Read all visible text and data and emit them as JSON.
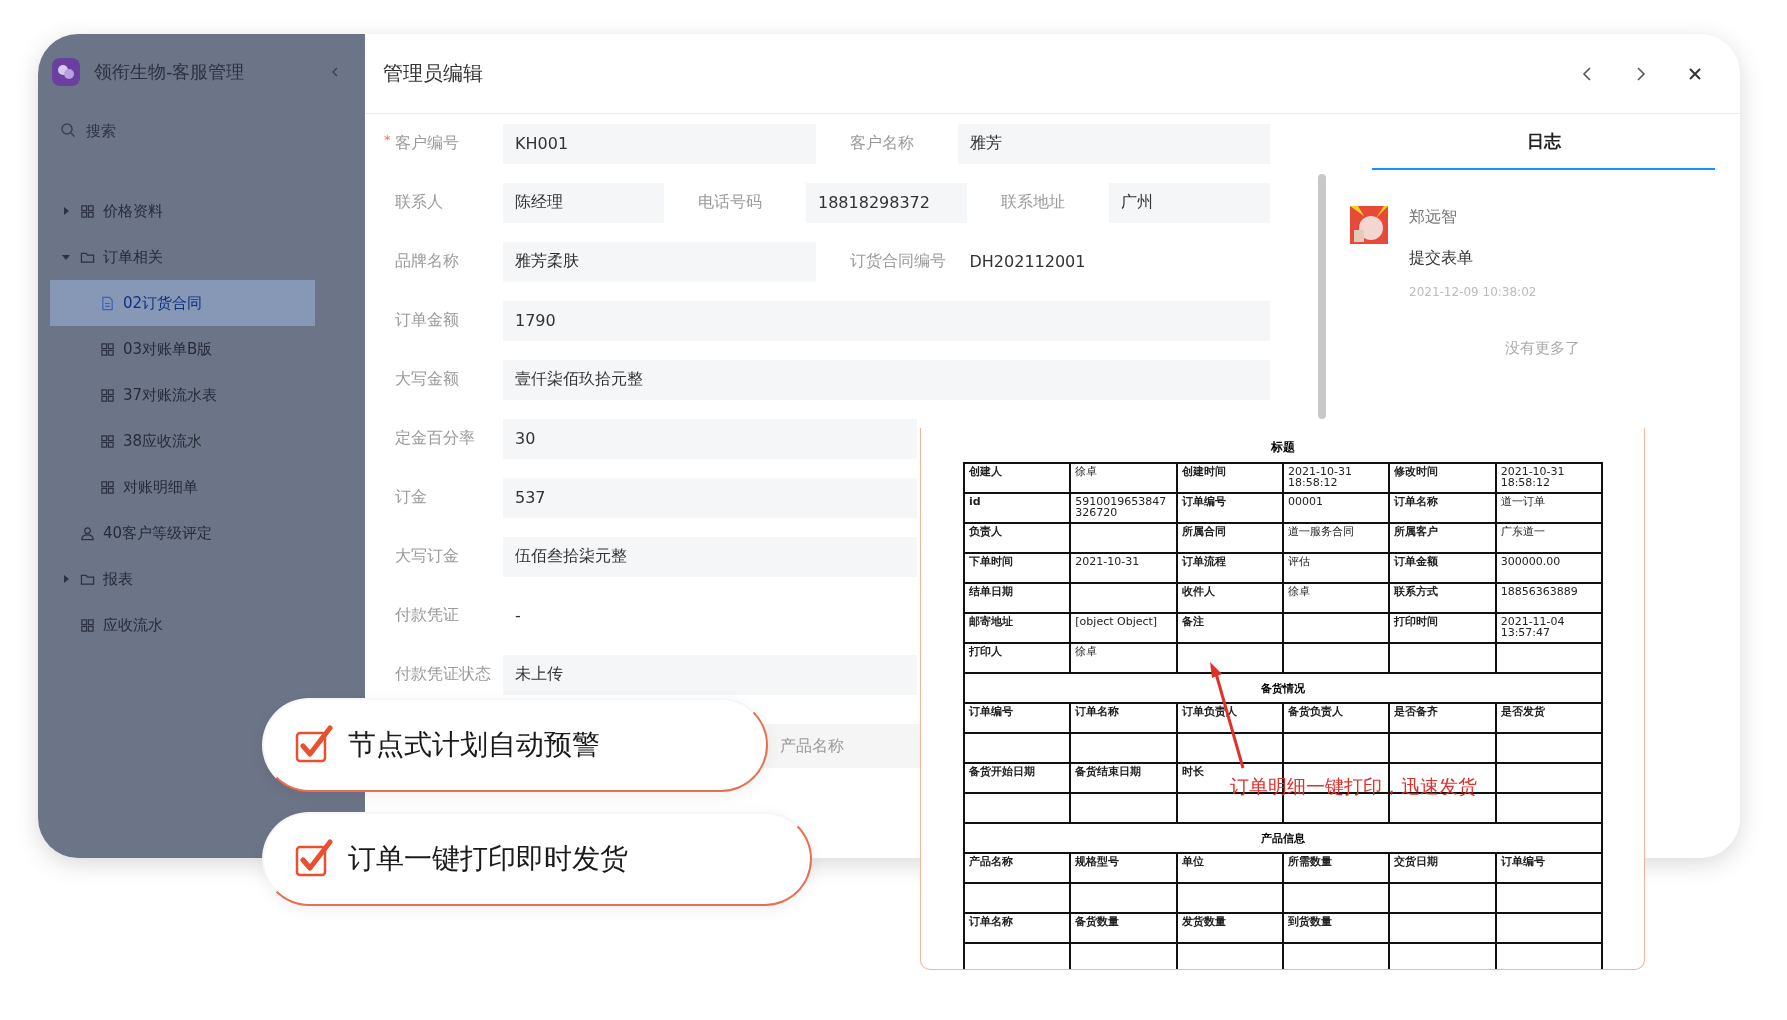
{
  "sidebar": {
    "brand": "领衔生物-客服管理",
    "search": {
      "placeholder": "搜索"
    },
    "items": [
      {
        "label": "价格资料",
        "kind": "grid",
        "expanded": false,
        "selected": false
      },
      {
        "label": "订单相关",
        "kind": "folder",
        "expanded": true,
        "selected": false,
        "children": [
          {
            "label": "02订货合同",
            "kind": "doc",
            "selected": true
          },
          {
            "label": "03对账单B版",
            "kind": "grid",
            "selected": false
          },
          {
            "label": "37对账流水表",
            "kind": "grid",
            "selected": false
          },
          {
            "label": "38应收流水",
            "kind": "grid",
            "selected": false
          },
          {
            "label": "对账明细单",
            "kind": "grid",
            "selected": false
          }
        ]
      },
      {
        "label": "40客户等级评定",
        "kind": "user",
        "selected": false
      },
      {
        "label": "报表",
        "kind": "folder",
        "expanded": false,
        "selected": false
      },
      {
        "label": "应收流水",
        "kind": "grid",
        "selected": false
      }
    ]
  },
  "dialog": {
    "title": "管理员编辑"
  },
  "form": {
    "rows": [
      {
        "fields": [
          {
            "label": "客户编号",
            "required_mark": "*",
            "kind": "input",
            "value": "KH001"
          },
          {
            "label": "客户名称",
            "kind": "input",
            "value": "雅芳"
          }
        ]
      },
      {
        "fields": [
          {
            "label": "联系人",
            "kind": "input",
            "value": "陈经理"
          },
          {
            "label": "电话号码",
            "kind": "input",
            "value": "18818298372"
          },
          {
            "label": "联系地址",
            "kind": "input",
            "value": "广州"
          }
        ]
      },
      {
        "fields": [
          {
            "label": "品牌名称",
            "kind": "input",
            "value": "雅芳柔肤"
          },
          {
            "label": "订货合同编号",
            "kind": "text",
            "value": "DH202112001"
          }
        ]
      },
      {
        "fields": [
          {
            "label": "订单金额",
            "kind": "input",
            "value": "1790"
          }
        ]
      },
      {
        "fields": [
          {
            "label": "大写金额",
            "kind": "input",
            "value": "壹仟柒佰玖拾元整"
          }
        ]
      },
      {
        "fields": [
          {
            "label": "定金百分率",
            "kind": "input",
            "value": "30"
          }
        ]
      },
      {
        "fields": [
          {
            "label": "订金",
            "kind": "input",
            "value": "537"
          }
        ]
      },
      {
        "fields": [
          {
            "label": "大写订金",
            "kind": "input",
            "value": "伍佰叁拾柒元整"
          }
        ]
      },
      {
        "fields": [
          {
            "label": "付款凭证",
            "kind": "text",
            "value": "-"
          }
        ]
      },
      {
        "fields": [
          {
            "label": "付款凭证状态",
            "kind": "input",
            "value": "未上传"
          }
        ]
      }
    ],
    "product_header": "产品名称"
  },
  "log": {
    "tab": {
      "label": "日志",
      "selected": true
    },
    "entries": [
      {
        "user": "郑远智",
        "action": "提交表单",
        "time": "2021-12-09 10:38:02"
      }
    ],
    "end_note": "没有更多了"
  },
  "callouts": [
    {
      "text": "节点式计划自动预警",
      "checked": true
    },
    {
      "text": "订单一键打印即时发货",
      "checked": true
    }
  ],
  "print_sheet": {
    "title": "标题",
    "rows": [
      {
        "kind": "pairs",
        "pairs": [
          {
            "label": "创建人",
            "value": "徐卓"
          },
          {
            "label": "创建时间",
            "value": "2021-10-31 18:58:12"
          },
          {
            "label": "修改时间",
            "value": "2021-10-31 18:58:12"
          }
        ]
      },
      {
        "kind": "pairs",
        "pairs": [
          {
            "label": "id",
            "value": "5910019653847326720"
          },
          {
            "label": "订单编号",
            "value": "00001"
          },
          {
            "label": "订单名称",
            "value": "道一订单"
          }
        ]
      },
      {
        "kind": "pairs",
        "pairs": [
          {
            "label": "负责人"
          },
          {
            "label": "所属合同",
            "value": "道一服务合同"
          },
          {
            "label": "所属客户",
            "value": "广东道一"
          }
        ]
      },
      {
        "kind": "pairs",
        "pairs": [
          {
            "label": "下单时间",
            "value": "2021-10-31"
          },
          {
            "label": "订单流程",
            "value": "评估"
          },
          {
            "label": "订单金额",
            "value": "300000.00"
          }
        ]
      },
      {
        "kind": "pairs",
        "pairs": [
          {
            "label": "结单日期"
          },
          {
            "label": "收件人",
            "value": "徐卓"
          },
          {
            "label": "联系方式",
            "value": "18856363889"
          }
        ]
      },
      {
        "kind": "pairs",
        "pairs": [
          {
            "label": "邮寄地址",
            "value": "[object Object]"
          },
          {
            "label": "备注"
          },
          {
            "label": "打印时间",
            "value": "2021-11-04 13:57:47"
          }
        ]
      },
      {
        "kind": "pairs",
        "pairs": [
          {
            "label": "打印人",
            "value": "徐卓"
          }
        ]
      },
      {
        "kind": "section",
        "text": "备货情况"
      },
      {
        "kind": "header",
        "cells": [
          "订单编号",
          "订单名称",
          "订单负责人",
          "备货负责人",
          "是否备齐",
          "是否发货"
        ]
      },
      {
        "kind": "blank"
      },
      {
        "kind": "header",
        "cells": [
          "备货开始日期",
          "备货结束日期",
          "时长"
        ]
      },
      {
        "kind": "blank"
      },
      {
        "kind": "section",
        "text": "产品信息"
      },
      {
        "kind": "header",
        "cells": [
          "产品名称",
          "规格型号",
          "单位",
          "所需数量",
          "交货日期",
          "订单编号"
        ]
      },
      {
        "kind": "blank"
      },
      {
        "kind": "header",
        "cells": [
          "订单名称",
          "备货数量",
          "发货数量",
          "到货数量"
        ]
      },
      {
        "kind": "blank"
      }
    ],
    "annotation": "订单明细一键打印，迅速发货"
  }
}
